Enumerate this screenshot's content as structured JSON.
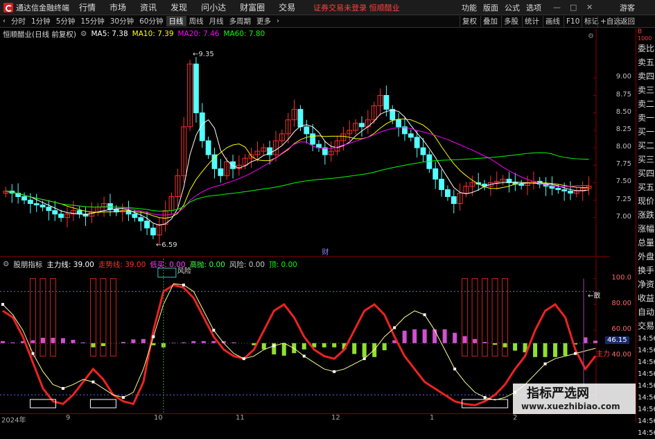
{
  "app": {
    "title": "通达信金融终端",
    "menus": [
      "行情",
      "市场",
      "资讯",
      "发现",
      "问小达",
      "财富圈",
      "交易"
    ],
    "warning": "证券交易未登录 恒顺醋业",
    "right_menus": [
      "功能",
      "版面",
      "公式",
      "选项"
    ],
    "guest": "游客",
    "window_ctrls": [
      "—",
      "□",
      "✕"
    ]
  },
  "toolbar": {
    "periods": [
      "分时",
      "1分钟",
      "5分钟",
      "15分钟",
      "30分钟",
      "60分钟",
      "日线",
      "周线",
      "月线",
      "多周期",
      "更多"
    ],
    "active": "日线",
    "right_buttons": [
      "复权",
      "叠加",
      "多股",
      "统计",
      "画线",
      "F10",
      "标记",
      "+自选",
      "返回"
    ]
  },
  "stock": {
    "name": "恒顺醋业(日线 前复权)",
    "ma": [
      {
        "label": "MA5: 7.38",
        "color": "#ffffff"
      },
      {
        "label": "MA10: 7.39",
        "color": "#ffff00"
      },
      {
        "label": "MA20: 7.46",
        "color": "#ff00ff"
      },
      {
        "label": "MA60: 7.80",
        "color": "#00ff00"
      }
    ],
    "high_label": "9.35",
    "low_label": "6.59",
    "event_label": "财"
  },
  "y_axis_main": [
    "9.00",
    "8.75",
    "8.50",
    "8.25",
    "8.00",
    "7.75",
    "7.50",
    "7.25",
    "7.00"
  ],
  "indicator": {
    "name": "股朋指标",
    "fields": [
      {
        "label": "主力线: 39.00",
        "color": "#ffffff"
      },
      {
        "label": "走势线: 39.00",
        "color": "#ff3030"
      },
      {
        "label": "低买: 0.00",
        "color": "#ff40ff"
      },
      {
        "label": "高抛: 0.00",
        "color": "#40ff40"
      },
      {
        "label": "风险: 0.00",
        "color": "#cccccc"
      },
      {
        "label": "顶: 0.00",
        "color": "#00ff00"
      }
    ],
    "risk_label": "风险",
    "scatter_label": "←散",
    "main_label": "主力",
    "current_value": "46.15"
  },
  "y_axis_ind": [
    "100.0",
    "80.00",
    "60.00",
    "40.00"
  ],
  "x_axis": [
    "2024年",
    "9",
    "10",
    "11",
    "12",
    "1",
    "2"
  ],
  "sidebar": {
    "items": [
      "委比",
      "卖五",
      "卖四",
      "卖三",
      "卖二",
      "卖一",
      "买一",
      "买二",
      "买三",
      "买四",
      "买五",
      "现价",
      "涨跌",
      "涨幅",
      "总量",
      "外盘",
      "换手",
      "净资",
      "收益",
      "自动",
      "交易"
    ],
    "times": [
      "14:56",
      "14:56",
      "14:56",
      "14:56",
      "14:56",
      "14:56",
      "14:56",
      "14:56",
      "14:56"
    ],
    "top_label": "B",
    "top_sub": "1000"
  },
  "watermark": {
    "title": "指标严选网",
    "url": "www.xuezhibiao.com"
  },
  "chart_data": [
    {
      "type": "candlestick",
      "title": "恒顺醋业(日线 前复权)",
      "ylim": [
        6.55,
        9.55
      ],
      "ticks": [
        9.0,
        8.75,
        8.5,
        8.25,
        8.0,
        7.75,
        7.5,
        7.25,
        7.0
      ],
      "closes": [
        7.38,
        7.35,
        7.3,
        7.25,
        7.2,
        7.18,
        7.15,
        7.1,
        7.05,
        7.0,
        7.05,
        7.1,
        7.05,
        7.02,
        7.08,
        7.15,
        7.2,
        7.12,
        7.08,
        7.1,
        7.05,
        7.0,
        6.95,
        6.85,
        6.75,
        6.9,
        7.1,
        7.3,
        7.6,
        8.3,
        9.2,
        8.5,
        8.1,
        7.9,
        7.7,
        7.6,
        7.8,
        7.7,
        7.75,
        7.85,
        7.9,
        7.95,
        8.0,
        7.9,
        8.1,
        8.2,
        8.4,
        8.55,
        8.3,
        8.2,
        8.05,
        8.0,
        7.9,
        7.95,
        8.1,
        8.2,
        8.25,
        8.35,
        8.3,
        8.4,
        8.6,
        8.75,
        8.55,
        8.4,
        8.3,
        8.2,
        8.15,
        8.0,
        7.9,
        7.7,
        7.55,
        7.4,
        7.3,
        7.2,
        7.35,
        7.45,
        7.5,
        7.48,
        7.45,
        7.5,
        7.52,
        7.55,
        7.5,
        7.48,
        7.46,
        7.5,
        7.52,
        7.48,
        7.45,
        7.42,
        7.4,
        7.38,
        7.35,
        7.38,
        7.42,
        7.45
      ],
      "ma": [
        {
          "name": "MA5",
          "color": "#ffffff"
        },
        {
          "name": "MA10",
          "color": "#ffff00"
        },
        {
          "name": "MA20",
          "color": "#ff00ff"
        },
        {
          "name": "MA60",
          "color": "#00ff00"
        }
      ]
    },
    {
      "type": "line",
      "title": "股朋指标",
      "ylim": [
        0,
        110
      ],
      "ticks": [
        100,
        80,
        60,
        40
      ],
      "series": [
        {
          "name": "主力线",
          "color": "#ffff99",
          "values": [
            80,
            72,
            60,
            42,
            28,
            18,
            15,
            18,
            22,
            20,
            15,
            10,
            8,
            12,
            30,
            55,
            80,
            96,
            95,
            90,
            75,
            60,
            50,
            42,
            38,
            40,
            45,
            48,
            50,
            46,
            40,
            35,
            30,
            28,
            30,
            34,
            38,
            45,
            55,
            62,
            70,
            75,
            72,
            60,
            45,
            30,
            20,
            12,
            8,
            6,
            8,
            12,
            18,
            26,
            34,
            38,
            40,
            42,
            44,
            46
          ]
        },
        {
          "name": "走势线",
          "color": "#ee2222",
          "values": [
            75,
            70,
            55,
            35,
            15,
            5,
            3,
            10,
            20,
            30,
            22,
            10,
            5,
            3,
            20,
            60,
            90,
            95,
            93,
            85,
            70,
            55,
            45,
            40,
            38,
            45,
            60,
            75,
            80,
            70,
            55,
            45,
            40,
            38,
            45,
            60,
            75,
            80,
            72,
            55,
            40,
            30,
            20,
            15,
            10,
            5,
            3,
            2,
            5,
            10,
            18,
            30,
            40,
            60,
            75,
            80,
            70,
            45,
            30,
            40
          ]
        }
      ]
    }
  ]
}
